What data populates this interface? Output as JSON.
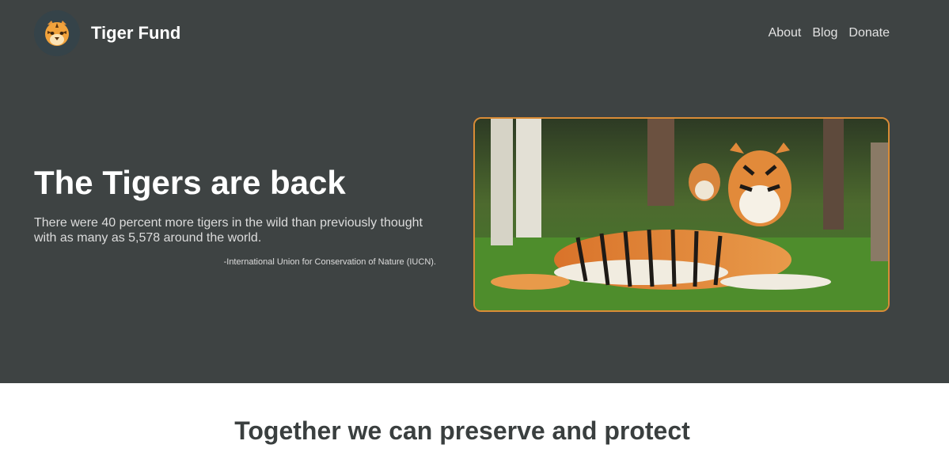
{
  "brand": {
    "name": "Tiger Fund",
    "logo_icon": "tiger-face-icon"
  },
  "nav": {
    "items": [
      "About",
      "Blog",
      "Donate"
    ]
  },
  "hero": {
    "title": "The Tigers are back",
    "lead": "There were 40 percent more tigers in the wild than previously thought with as many as 5,578 around the world.",
    "citation": "-International Union for Conservation of Nature (IUCN).",
    "image_icon": "tiger-photo"
  },
  "section": {
    "title": "Together we can preserve and protect"
  },
  "colors": {
    "hero_bg": "#3e4343",
    "accent": "#d98c36",
    "text_dark": "#3a3f3f"
  }
}
